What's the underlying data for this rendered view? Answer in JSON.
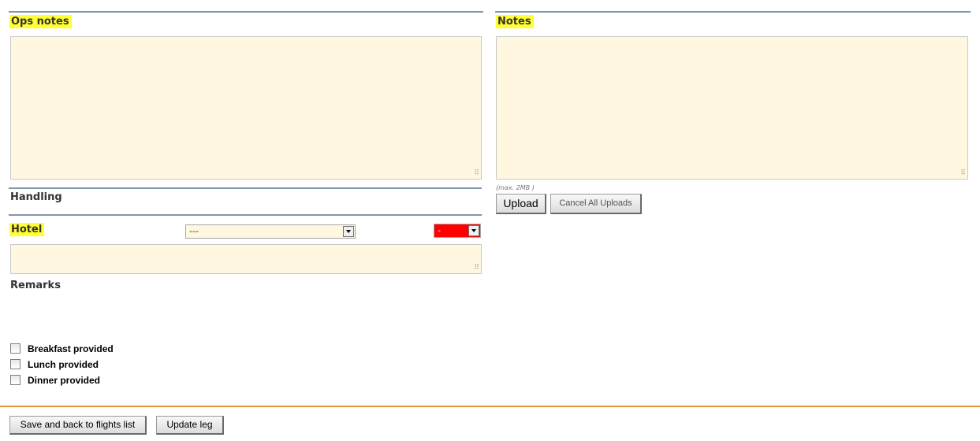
{
  "ops_notes": {
    "title": "Ops notes",
    "value": ""
  },
  "notes": {
    "title": "Notes",
    "value": ""
  },
  "handling": {
    "title": "Handling"
  },
  "hotel": {
    "title": "Hotel",
    "select_value": "---",
    "status_value": "-",
    "status_color": "#ff0000",
    "value": ""
  },
  "remarks": {
    "title": "Remarks"
  },
  "upload": {
    "max_note": "(max. 2MB )",
    "upload_label": "Upload",
    "cancel_label": "Cancel All Uploads"
  },
  "meals": [
    {
      "label": "Breakfast provided",
      "checked": false
    },
    {
      "label": "Lunch provided",
      "checked": false
    },
    {
      "label": "Dinner provided",
      "checked": false
    }
  ],
  "footer": {
    "save_label": "Save and back to flights list",
    "update_label": "Update leg"
  },
  "colors": {
    "highlight": "#ffff33",
    "field_bg": "#fff7df",
    "divider": "#7d96b0",
    "footer_line": "#e39b3b"
  }
}
